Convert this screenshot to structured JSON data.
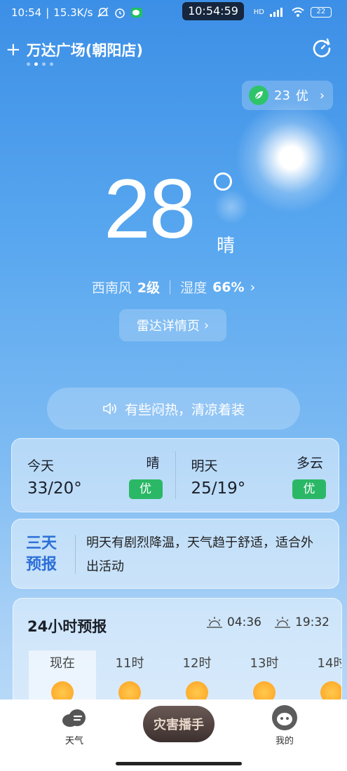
{
  "status_bar": {
    "time": "10:54",
    "net_speed": "15.3K/s",
    "center_clock": "10:54:59",
    "signal_label": "HD",
    "battery": "22"
  },
  "header": {
    "location": "万达广场(朝阳店)",
    "page_dots": 4,
    "active_dot": 1
  },
  "aqi": {
    "value": "23",
    "level": "优"
  },
  "current": {
    "temperature": "28",
    "condition": "晴",
    "wind_dir": "西南风",
    "wind_level": "2级",
    "humidity_label": "湿度",
    "humidity": "66%",
    "radar_label": "雷达详情页",
    "tip": "有些闷热，清凉着装"
  },
  "forecast": [
    {
      "day": "今天",
      "weather": "晴",
      "temp": "33/20°",
      "aqi": "优"
    },
    {
      "day": "明天",
      "weather": "多云",
      "temp": "25/19°",
      "aqi": "优"
    }
  ],
  "three_day": {
    "title": "三天预报",
    "text": "明天有剧烈降温，天气趋于舒适，适合外出活动"
  },
  "hourly": {
    "title": "24小时预报",
    "sunrise": "04:36",
    "sunset": "19:32",
    "hours": [
      {
        "label": "现在"
      },
      {
        "label": "11时"
      },
      {
        "label": "12时"
      },
      {
        "label": "13时"
      },
      {
        "label": "14时"
      }
    ]
  },
  "bottom_nav": {
    "weather": "天气",
    "disaster": "灾害播手",
    "mine": "我的"
  },
  "colors": {
    "bg_top": "#3c8fe6",
    "bg_bottom": "#c4e0f8",
    "good_badge": "#2bb866",
    "three_day_title": "#2c6fd8",
    "sun": "#ffad2e"
  }
}
